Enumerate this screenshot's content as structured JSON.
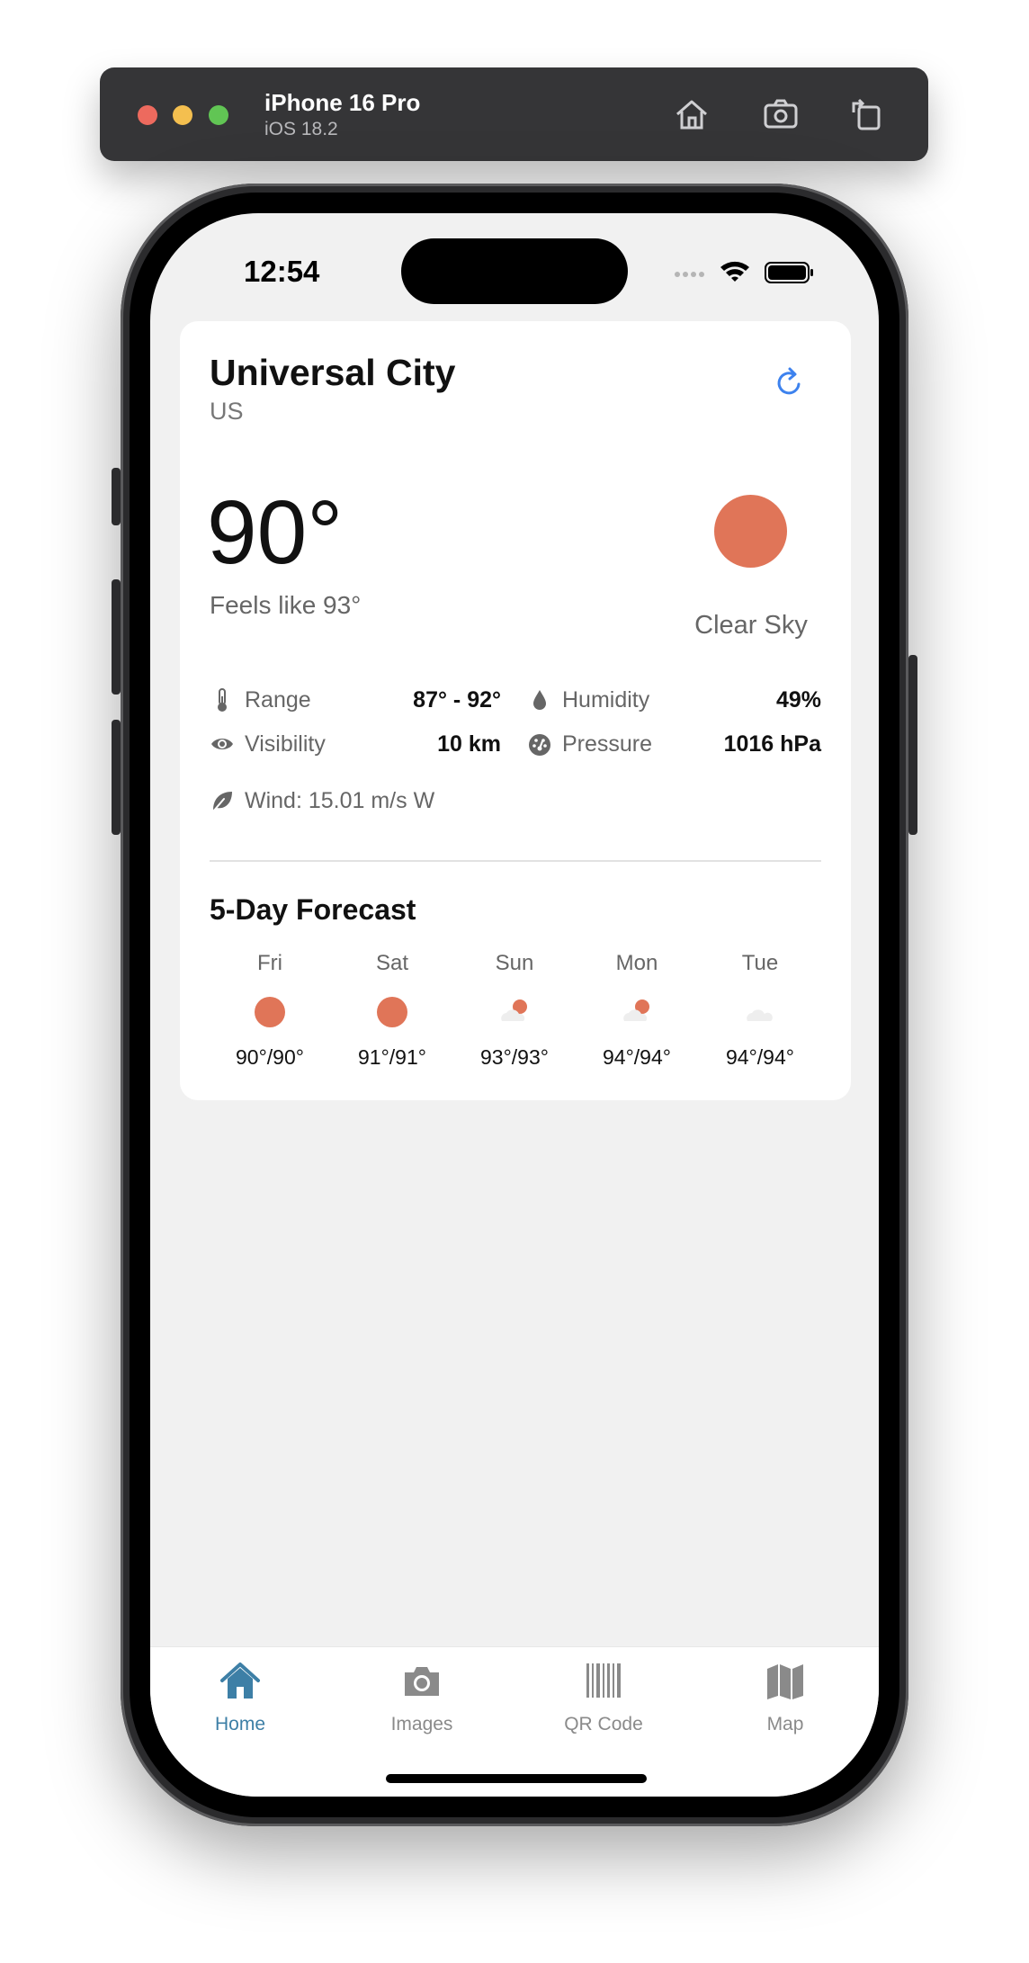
{
  "simulator": {
    "device_name": "iPhone 16 Pro",
    "os_version": "iOS 18.2",
    "buttons": [
      {
        "icon": "home-icon"
      },
      {
        "icon": "screenshot-icon"
      },
      {
        "icon": "rotate-icon"
      }
    ]
  },
  "status_bar": {
    "time": "12:54"
  },
  "weather": {
    "city": "Universal City",
    "country": "US",
    "temperature": "90°",
    "feels_like": "Feels like 93°",
    "condition": "Clear Sky",
    "accent_color": "#e07558",
    "stats": {
      "range_label": "Range",
      "range_value": "87° - 92°",
      "humidity_label": "Humidity",
      "humidity_value": "49%",
      "visibility_label": "Visibility",
      "visibility_value": "10 km",
      "pressure_label": "Pressure",
      "pressure_value": "1016 hPa"
    },
    "wind": "Wind: 15.01 m/s W"
  },
  "forecast": {
    "title": "5-Day Forecast",
    "days": [
      {
        "name": "Fri",
        "temps": "90°/90°",
        "icon": "sun-icon"
      },
      {
        "name": "Sat",
        "temps": "91°/91°",
        "icon": "sun-icon"
      },
      {
        "name": "Sun",
        "temps": "93°/93°",
        "icon": "partly-cloudy-icon"
      },
      {
        "name": "Mon",
        "temps": "94°/94°",
        "icon": "partly-cloudy-icon"
      },
      {
        "name": "Tue",
        "temps": "94°/94°",
        "icon": "cloud-icon"
      }
    ]
  },
  "tabbar": {
    "active_color": "#3d7fa6",
    "tabs": [
      {
        "label": "Home",
        "icon": "home-icon",
        "active": true
      },
      {
        "label": "Images",
        "icon": "camera-icon",
        "active": false
      },
      {
        "label": "QR Code",
        "icon": "barcode-icon",
        "active": false
      },
      {
        "label": "Map",
        "icon": "map-icon",
        "active": false
      }
    ]
  }
}
